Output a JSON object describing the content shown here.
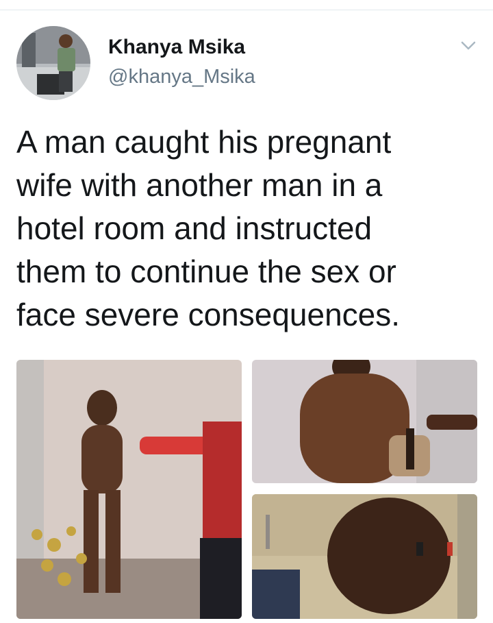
{
  "tweet": {
    "author": {
      "display_name": "Khanya Msika",
      "handle": "@khanya_Msika",
      "avatar_icon": "profile-photo"
    },
    "menu_icon": "chevron-down-icon",
    "text": "A man caught his pregnant\nwife with another man in a\nhotel room and instructed\nthem to continue the sex or\nface severe consequences.",
    "media": [
      {
        "icon": "photo-man-covering-face"
      },
      {
        "icon": "photo-shirtless-man-holding-belt"
      },
      {
        "icon": "photo-man-in-bathroom"
      }
    ]
  },
  "colors": {
    "text_primary": "#14171a",
    "text_secondary": "#657786",
    "divider": "#e1e8ed"
  }
}
